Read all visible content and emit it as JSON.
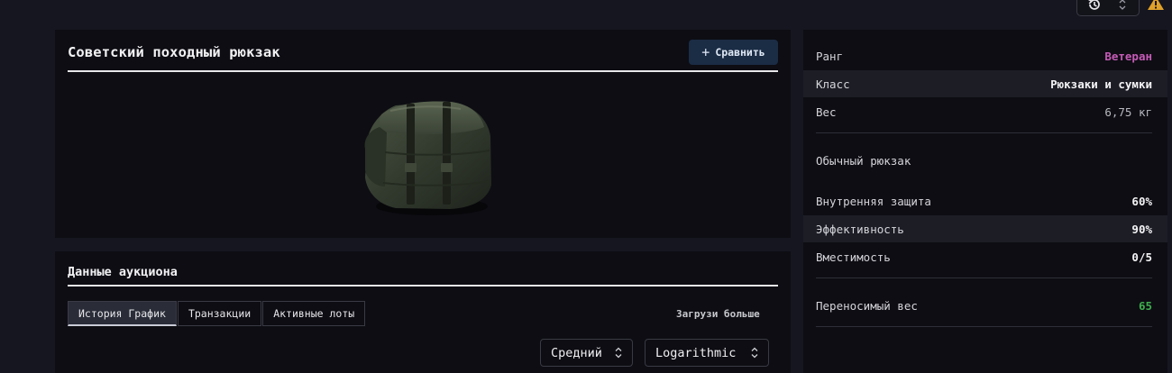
{
  "item": {
    "title": "Советский походный рюкзак",
    "compare_label": "Сравнить"
  },
  "auction": {
    "title": "Данные аукциона",
    "tabs": [
      {
        "label": "История График",
        "active": true
      },
      {
        "label": "Транзакции",
        "active": false
      },
      {
        "label": "Активные лоты",
        "active": false
      }
    ],
    "load_more": "Загрузи больше",
    "select_mode": "Средний",
    "select_scale": "Logarithmic"
  },
  "stats": {
    "rank_label": "Ранг",
    "rank_value": "Ветеран",
    "class_label": "Класс",
    "class_value": "Рюкзаки и сумки",
    "weight_label": "Вес",
    "weight_value": "6,75 кг",
    "type_label": "Обычный рюкзак",
    "protection_label": "Внутренняя защита",
    "protection_value": "60%",
    "efficiency_label": "Эффективность",
    "efficiency_value": "90%",
    "capacity_label": "Вместимость",
    "capacity_value": "0/5",
    "carry_label": "Переносимый вес",
    "carry_value": "65"
  },
  "colors": {
    "rank": "#c65bb7",
    "carry": "#3fae4e",
    "accent_button": "#1b2c45",
    "warning": "#e0a12a"
  },
  "icons": {
    "history": "history-icon",
    "chevron": "chevron-updown-icon",
    "warning": "warning-triangle-icon",
    "plus": "plus-icon"
  }
}
